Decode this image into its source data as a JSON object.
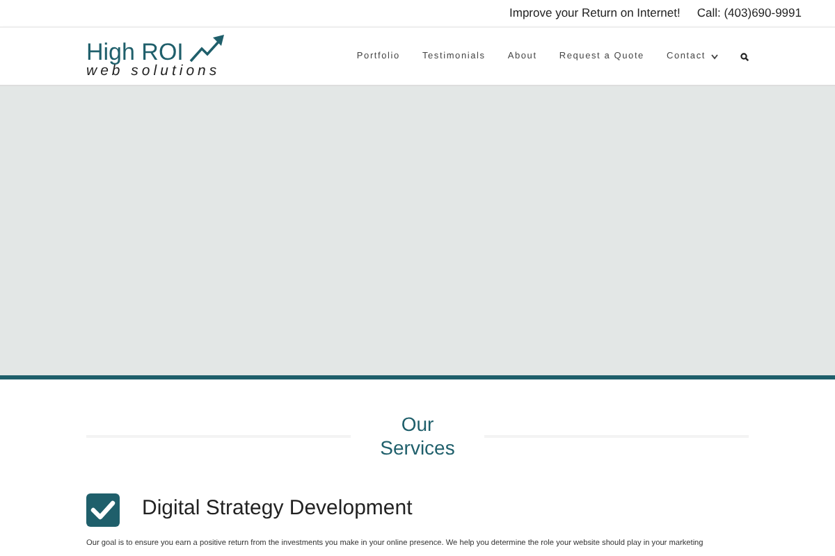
{
  "top_bar": {
    "tagline": "Improve your Return on Internet!",
    "phone": "Call: (403)690-9991"
  },
  "logo": {
    "title": "High ROI",
    "subtitle": "web solutions"
  },
  "nav": [
    {
      "label": "Portfolio",
      "kind": "link"
    },
    {
      "label": "Testimonials",
      "kind": "link"
    },
    {
      "label": "About",
      "kind": "link"
    },
    {
      "label": "Request a Quote",
      "kind": "link"
    },
    {
      "label": "Contact",
      "kind": "dropdown"
    },
    {
      "kind": "search"
    }
  ],
  "section": {
    "heading": "Our Services"
  },
  "services": [
    {
      "title": "Digital Strategy Development",
      "text": "Our goal is to ensure you earn a positive return from the investments you make in your online presence. We help you determine the role your website should play in your marketing"
    }
  ]
}
